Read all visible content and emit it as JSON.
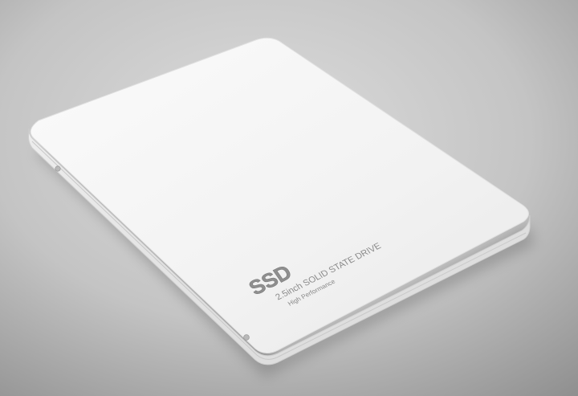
{
  "product": {
    "logo_text": "SSD",
    "title": "2.5inch SOLID STATE DRIVE",
    "subtitle": "High Performance"
  },
  "colors": {
    "background_center": "#d9d9d9",
    "background_edge": "#9a9a9a",
    "drive_face": "#f3f3f3",
    "drive_edge": "#e2e2e2",
    "label_text": "#8a8a8a"
  }
}
